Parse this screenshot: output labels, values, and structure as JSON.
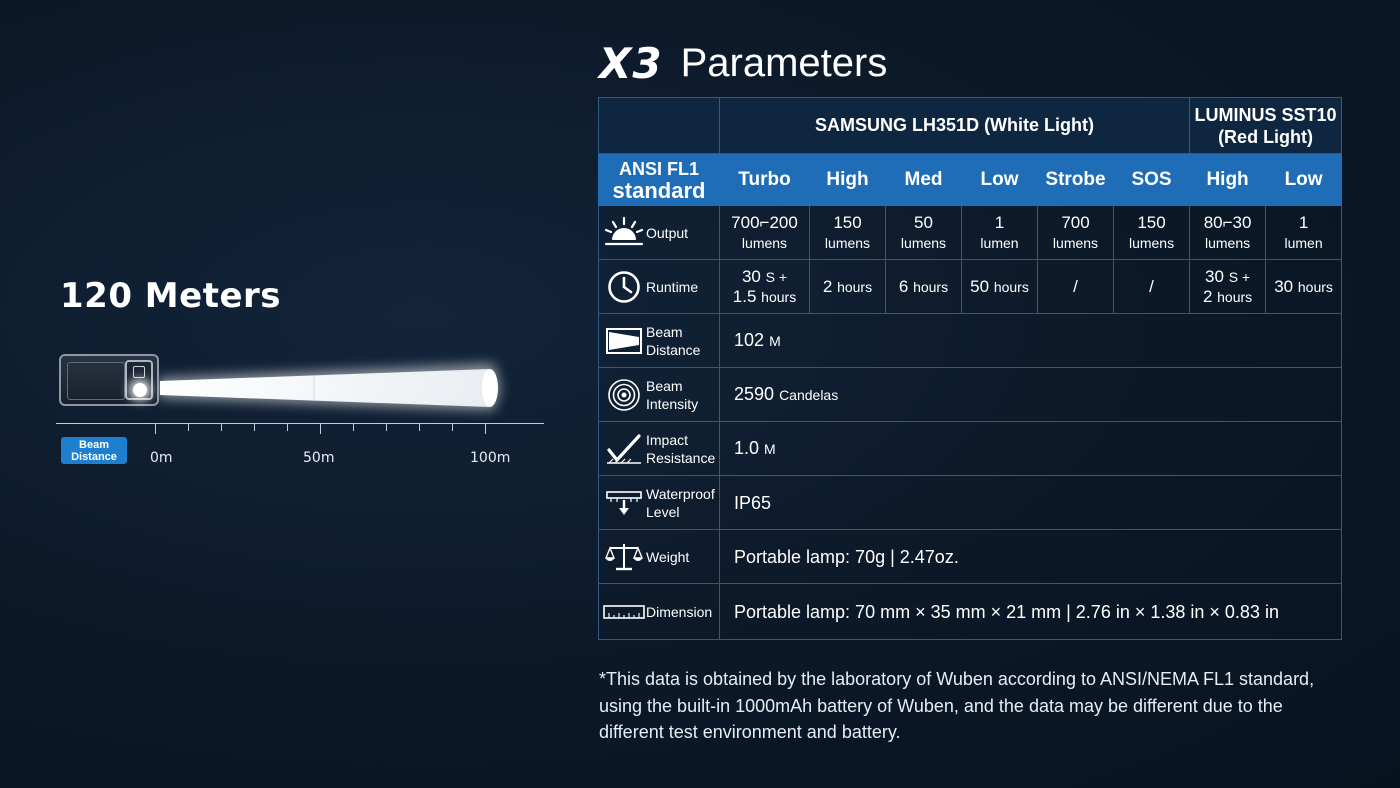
{
  "beam": {
    "title": "120 Meters",
    "badge_line1": "Beam",
    "badge_line2": "Distance",
    "ticks": [
      "0m",
      "50m",
      "100m"
    ]
  },
  "params": {
    "model": "X3",
    "title": "Parameters",
    "led_white": "SAMSUNG LH351D (White Light)",
    "led_red_line1": "LUMINUS SST10",
    "led_red_line2": "(Red Light)",
    "standard_line1": "ANSI FL1",
    "standard_line2": "standard",
    "modes": [
      "Turbo",
      "High",
      "Med",
      "Low",
      "Strobe",
      "SOS",
      "High",
      "Low"
    ],
    "output": {
      "label": "Output",
      "values": [
        {
          "v": "700⌐200",
          "u": "lumens"
        },
        {
          "v": "150",
          "u": "lumens"
        },
        {
          "v": "50",
          "u": "lumens"
        },
        {
          "v": "1",
          "u": "lumen"
        },
        {
          "v": "700",
          "u": "lumens"
        },
        {
          "v": "150",
          "u": "lumens"
        },
        {
          "v": "80⌐30",
          "u": "lumens"
        },
        {
          "v": "1",
          "u": "lumen"
        }
      ]
    },
    "runtime": {
      "label": "Runtime",
      "turbo_a": "30",
      "turbo_a_unit": "S +",
      "turbo_b": "1.5",
      "turbo_b_unit": "hours",
      "high": "2",
      "high_unit": "hours",
      "med": "6",
      "med_unit": "hours",
      "low": "50",
      "low_unit": "hours",
      "strobe": "/",
      "sos": "/",
      "red_high_a": "30",
      "red_high_a_unit": "S +",
      "red_high_b": "2",
      "red_high_b_unit": "hours",
      "red_low": "30",
      "red_low_unit": "hours"
    },
    "beam_distance": {
      "label1": "Beam",
      "label2": "Distance",
      "value": "102",
      "unit": "M"
    },
    "beam_intensity": {
      "label1": "Beam",
      "label2": "Intensity",
      "value": "2590",
      "unit": "Candelas"
    },
    "impact": {
      "label1": "Impact",
      "label2": "Resistance",
      "value": "1.0",
      "unit": "M"
    },
    "waterproof": {
      "label1": "Waterproof",
      "label2": "Level",
      "value": "IP65"
    },
    "weight": {
      "label": "Weight",
      "value": "Portable lamp: 70g | 2.47oz."
    },
    "dimension": {
      "label": "Dimension",
      "value": "Portable lamp: 70 mm × 35 mm × 21 mm | 2.76 in × 1.38 in × 0.83 in"
    }
  },
  "footnote_line1": "*This data is obtained by the laboratory of Wuben according to ANSI/NEMA FL1 standard,",
  "footnote_line2": "using the  built-in 1000mAh battery of Wuben, and the data may be different due to the",
  "footnote_line3": "different test  environment and battery.",
  "colors": {
    "background": "#0d1a2a",
    "accent": "#1f6db7",
    "grid": "#2e5a86",
    "badge": "#1e7fd0"
  }
}
